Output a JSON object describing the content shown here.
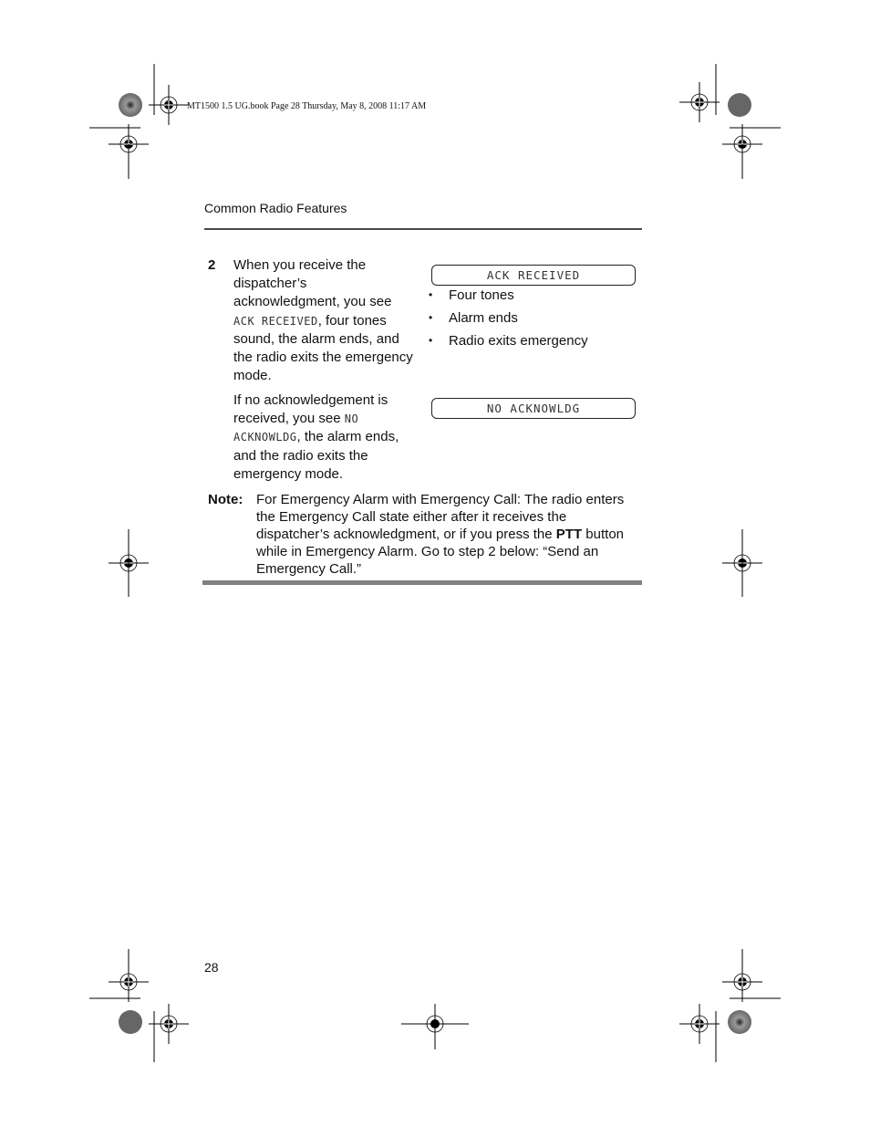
{
  "slug": "MT1500 1.5 UG.book  Page 28  Thursday, May 8, 2008  11:17 AM",
  "running_head": "Common Radio Features",
  "step": {
    "number": "2",
    "para1": {
      "before": "When you receive the dispatcher’s acknowledgment, you see ",
      "lcd": "ACK RECEIVED",
      "after": ", four tones sound, the alarm ends, and the radio exits the emergency mode."
    },
    "para2": {
      "before": "If no acknowledgement is received, you see ",
      "lcd": "NO ACKNOWLDG",
      "after": ", the alarm ends, and the radio exits the emergency mode."
    }
  },
  "displays": {
    "lcd1": "ACK RECEIVED",
    "lcd2": "NO ACKNOWLDG"
  },
  "bullets": [
    "Four tones",
    "Alarm ends",
    "Radio exits emergency"
  ],
  "bullet_glyph": "•",
  "note": {
    "label": "Note:",
    "before": "For Emergency Alarm with Emergency Call: The radio enters the Emergency Call state either after it receives the dispatcher’s acknowledgment, or if you press the ",
    "bold": "PTT",
    "after": " button while in Emergency Alarm. Go to step 2 below: “Send an Emergency Call.”"
  },
  "page_number": "28",
  "registration_marks": [
    "crosshair-icon",
    "starburst-icon",
    "solid-disc-icon"
  ]
}
